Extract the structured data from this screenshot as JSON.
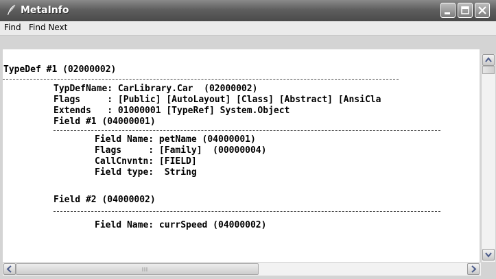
{
  "window": {
    "title": "MetaInfo",
    "icon": "feather-pen-icon",
    "controls": [
      "minimize-icon",
      "maximize-icon",
      "close-icon"
    ]
  },
  "menu": {
    "items": [
      {
        "label": "Find"
      },
      {
        "label": "Find Next"
      }
    ]
  },
  "content": {
    "lines": [
      "TypeDef #1 (02000002)",
      "TypDefName: CarLibrary.Car  (02000002)",
      "Flags     : [Public] [AutoLayout] [Class] [Abstract] [AnsiCla",
      "Extends   : 01000001 [TypeRef] System.Object",
      "Field #1 (04000001)",
      "Field Name: petName (04000001)",
      "Flags     : [Family]  (00000004)",
      "CallCnvntn: [FIELD]",
      "Field type:  String",
      "Field #2 (04000002)",
      "Field Name: currSpeed (04000002)"
    ]
  },
  "scrollbars": {
    "vertical": [
      "up-arrow-icon",
      "down-arrow-icon"
    ],
    "horizontal": [
      "left-arrow-icon",
      "right-arrow-icon"
    ]
  }
}
